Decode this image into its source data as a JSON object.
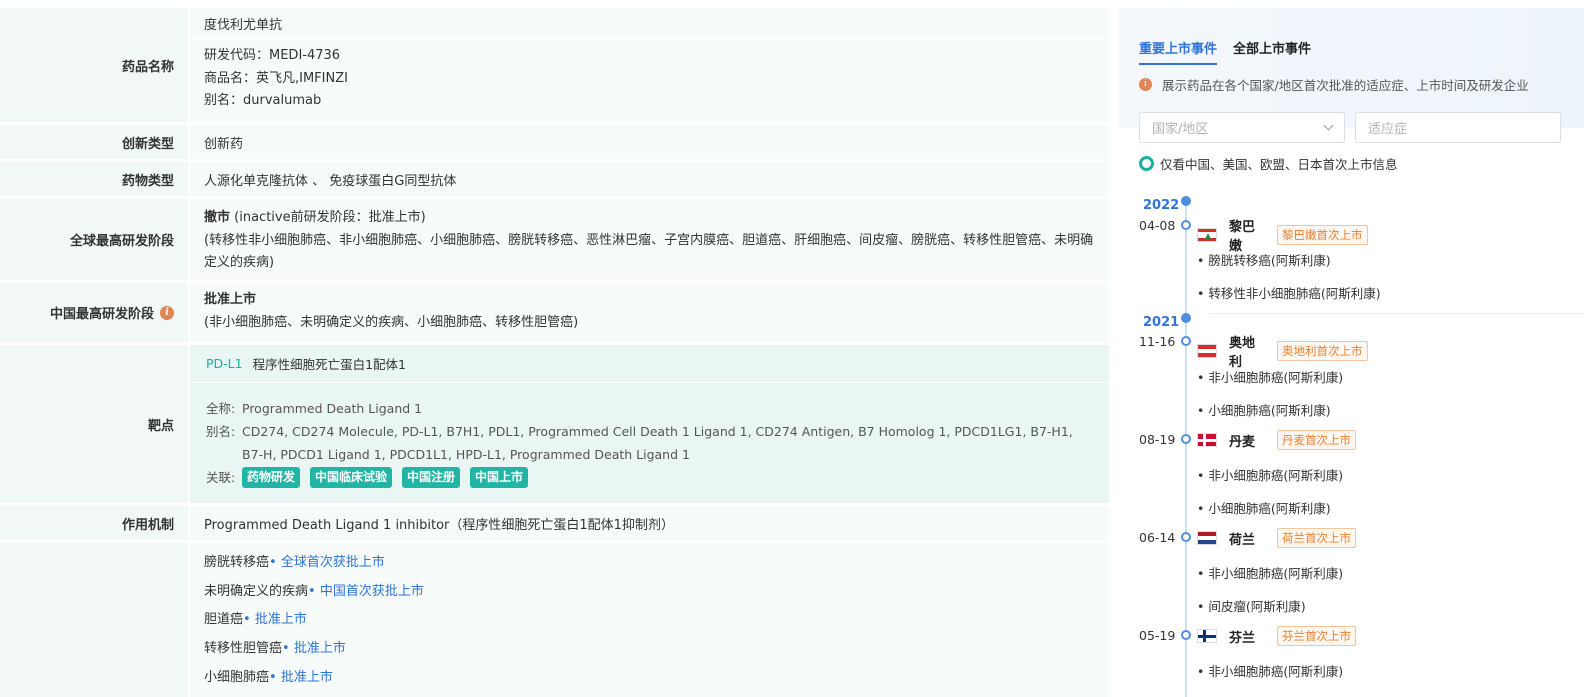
{
  "info": {
    "drug_name": {
      "label": "药品名称",
      "primary": "度伐利尤单抗",
      "code": "研发代码：MEDI-4736",
      "trade": "商品名：英飞凡,IMFINZI",
      "alias": "别名：durvalumab"
    },
    "innovation": {
      "label": "创新类型",
      "value": "创新药"
    },
    "drug_type": {
      "label": "药物类型",
      "value": "人源化单克隆抗体 、 免疫球蛋白G同型抗体"
    },
    "global_stage": {
      "label": "全球最高研发阶段",
      "status": "撤市",
      "status_note": "(inactive前研发阶段：批准上市)",
      "indications": "(转移性非小细胞肺癌、非小细胞肺癌、小细胞肺癌、膀胱转移癌、恶性淋巴瘤、子宫内膜癌、胆道癌、肝细胞癌、间皮瘤、膀胱癌、转移性胆管癌、未明确定义的疾病)"
    },
    "china_stage": {
      "label": "中国最高研发阶段",
      "status": "批准上市",
      "indications": "(非小细胞肺癌、未明确定义的疾病、小细胞肺癌、转移性胆管癌)"
    },
    "target": {
      "label": "靶点",
      "code": "PD-L1",
      "name": "程序性细胞死亡蛋白1配体1",
      "full_name_key": "全称:",
      "full_name": "Programmed Death Ligand 1",
      "alias_key": "别名:",
      "aliases": "CD274, CD274 Molecule, PD-L1, B7H1, PDL1, Programmed Cell Death 1 Ligand 1, CD274 Antigen, B7 Homolog 1, PDCD1LG1, B7-H1, B7-H, PDCD1 Ligand 1, PDCD1L1, HPD-L1, Programmed Death Ligand 1",
      "related_key": "关联:",
      "tags": [
        "药物研发",
        "中国临床试验",
        "中国注册",
        "中国上市"
      ]
    },
    "mechanism": {
      "label": "作用机制",
      "value": "Programmed Death Ligand 1 inhibitor（程序性细胞死亡蛋白1配体1抑制剂）"
    },
    "approvals": [
      {
        "indication": "膀胱转移癌",
        "status": "• 全球首次获批上市"
      },
      {
        "indication": "未明确定义的疾病",
        "status": "• 中国首次获批上市"
      },
      {
        "indication": "胆道癌",
        "status": "• 批准上市"
      },
      {
        "indication": "转移性胆管癌",
        "status": "• 批准上市"
      },
      {
        "indication": "小细胞肺癌",
        "status": "• 批准上市"
      }
    ]
  },
  "market_panel": {
    "tabs": [
      "重要上市事件",
      "全部上市事件"
    ],
    "note": "展示药品在各个国家/地区首次批准的适应症、上市时间及研发企业",
    "country_placeholder": "国家/地区",
    "indication_placeholder": "适应症",
    "filter_label": "仅看中国、美国、欧盟、日本首次上市信息",
    "years": [
      "2022",
      "2021"
    ],
    "events": [
      {
        "date": "04-08",
        "country": "黎巴嫩",
        "flag": "lebanon-flag-icon",
        "badge": "黎巴嫩首次上市",
        "indications": [
          "• 膀胱转移癌(阿斯利康)",
          "• 转移性非小细胞肺癌(阿斯利康)"
        ]
      },
      {
        "date": "11-16",
        "country": "奥地利",
        "flag": "austria-flag-icon",
        "badge": "奥地利首次上市",
        "indications": [
          "• 非小细胞肺癌(阿斯利康)",
          "• 小细胞肺癌(阿斯利康)"
        ]
      },
      {
        "date": "08-19",
        "country": "丹麦",
        "flag": "denmark-flag-icon",
        "badge": "丹麦首次上市",
        "indications": [
          "• 非小细胞肺癌(阿斯利康)",
          "• 小细胞肺癌(阿斯利康)"
        ]
      },
      {
        "date": "06-14",
        "country": "荷兰",
        "flag": "netherlands-flag-icon",
        "badge": "荷兰首次上市",
        "indications": [
          "• 非小细胞肺癌(阿斯利康)",
          "• 间皮瘤(阿斯利康)"
        ]
      },
      {
        "date": "05-19",
        "country": "芬兰",
        "flag": "finland-flag-icon",
        "badge": "芬兰首次上市",
        "indications": [
          "• 非小细胞肺癌(阿斯利康)"
        ]
      }
    ],
    "colors": {
      "accent": "#2f74d6",
      "teal": "#22b5a5",
      "badge": "#ec7f2f"
    }
  }
}
